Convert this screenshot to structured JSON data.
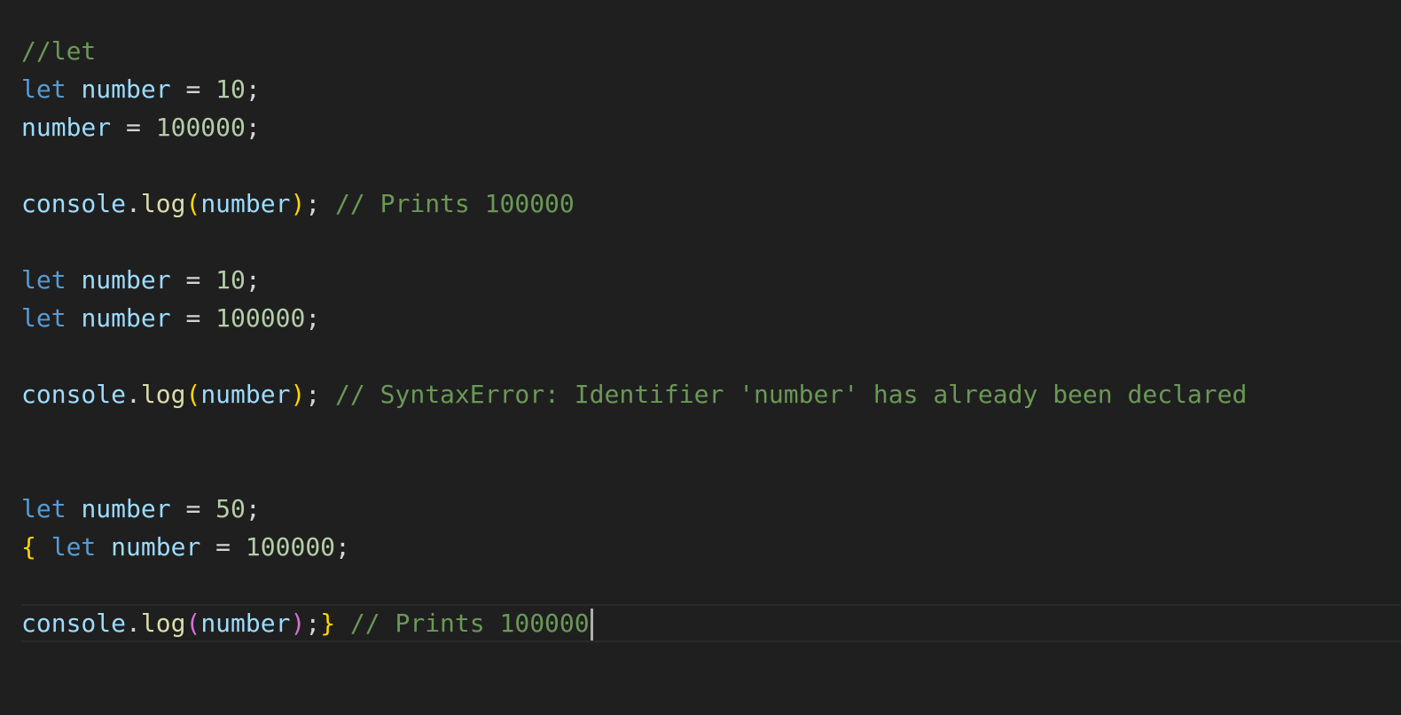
{
  "editor": {
    "theme_colors": {
      "background": "#1f1f1f",
      "comment": "#6a9955",
      "keyword": "#569cd6",
      "variable": "#9cdcfe",
      "number": "#b5cea8",
      "function": "#dcdcaa",
      "bracket_gold": "#ffd700",
      "bracket_pink": "#da70d6"
    },
    "lines": [
      {
        "tokens": [
          {
            "t": "comment",
            "v": "//let"
          }
        ]
      },
      {
        "tokens": [
          {
            "t": "keyword",
            "v": "let"
          },
          {
            "t": "op",
            "v": " "
          },
          {
            "t": "var",
            "v": "number"
          },
          {
            "t": "op",
            "v": " = "
          },
          {
            "t": "num",
            "v": "10"
          },
          {
            "t": "op",
            "v": ";"
          }
        ]
      },
      {
        "tokens": [
          {
            "t": "var",
            "v": "number"
          },
          {
            "t": "op",
            "v": " = "
          },
          {
            "t": "num",
            "v": "100000"
          },
          {
            "t": "op",
            "v": ";"
          }
        ]
      },
      {
        "tokens": []
      },
      {
        "tokens": [
          {
            "t": "var",
            "v": "console"
          },
          {
            "t": "op",
            "v": "."
          },
          {
            "t": "func",
            "v": "log"
          },
          {
            "t": "bracket-gold",
            "v": "("
          },
          {
            "t": "var",
            "v": "number"
          },
          {
            "t": "bracket-gold",
            "v": ")"
          },
          {
            "t": "op",
            "v": "; "
          },
          {
            "t": "comment",
            "v": "// Prints 100000"
          }
        ]
      },
      {
        "tokens": []
      },
      {
        "tokens": [
          {
            "t": "keyword",
            "v": "let"
          },
          {
            "t": "op",
            "v": " "
          },
          {
            "t": "var",
            "v": "number"
          },
          {
            "t": "op",
            "v": " = "
          },
          {
            "t": "num",
            "v": "10"
          },
          {
            "t": "op",
            "v": ";"
          }
        ]
      },
      {
        "tokens": [
          {
            "t": "keyword",
            "v": "let"
          },
          {
            "t": "op",
            "v": " "
          },
          {
            "t": "var",
            "v": "number"
          },
          {
            "t": "op",
            "v": " = "
          },
          {
            "t": "num",
            "v": "100000"
          },
          {
            "t": "op",
            "v": ";"
          }
        ]
      },
      {
        "tokens": []
      },
      {
        "tokens": [
          {
            "t": "var",
            "v": "console"
          },
          {
            "t": "op",
            "v": "."
          },
          {
            "t": "func",
            "v": "log"
          },
          {
            "t": "bracket-gold",
            "v": "("
          },
          {
            "t": "var",
            "v": "number"
          },
          {
            "t": "bracket-gold",
            "v": ")"
          },
          {
            "t": "op",
            "v": "; "
          },
          {
            "t": "comment",
            "v": "// SyntaxError: Identifier 'number' has already been declared"
          }
        ]
      },
      {
        "tokens": []
      },
      {
        "tokens": []
      },
      {
        "tokens": [
          {
            "t": "keyword",
            "v": "let"
          },
          {
            "t": "op",
            "v": " "
          },
          {
            "t": "var",
            "v": "number"
          },
          {
            "t": "op",
            "v": " = "
          },
          {
            "t": "num",
            "v": "50"
          },
          {
            "t": "op",
            "v": ";"
          }
        ]
      },
      {
        "tokens": [
          {
            "t": "bracket-gold",
            "v": "{"
          },
          {
            "t": "op",
            "v": " "
          },
          {
            "t": "keyword",
            "v": "let"
          },
          {
            "t": "op",
            "v": " "
          },
          {
            "t": "var",
            "v": "number"
          },
          {
            "t": "op",
            "v": " = "
          },
          {
            "t": "num",
            "v": "100000"
          },
          {
            "t": "op",
            "v": ";"
          }
        ]
      },
      {
        "tokens": []
      },
      {
        "tokens": [
          {
            "t": "var",
            "v": "console"
          },
          {
            "t": "op",
            "v": "."
          },
          {
            "t": "func",
            "v": "log"
          },
          {
            "t": "bracket-pink",
            "v": "("
          },
          {
            "t": "var",
            "v": "number"
          },
          {
            "t": "bracket-pink",
            "v": ")"
          },
          {
            "t": "op",
            "v": ";"
          },
          {
            "t": "bracket-gold",
            "v": "}"
          },
          {
            "t": "op",
            "v": " "
          },
          {
            "t": "comment",
            "v": "// Prints 100000"
          }
        ],
        "current": true
      }
    ]
  }
}
